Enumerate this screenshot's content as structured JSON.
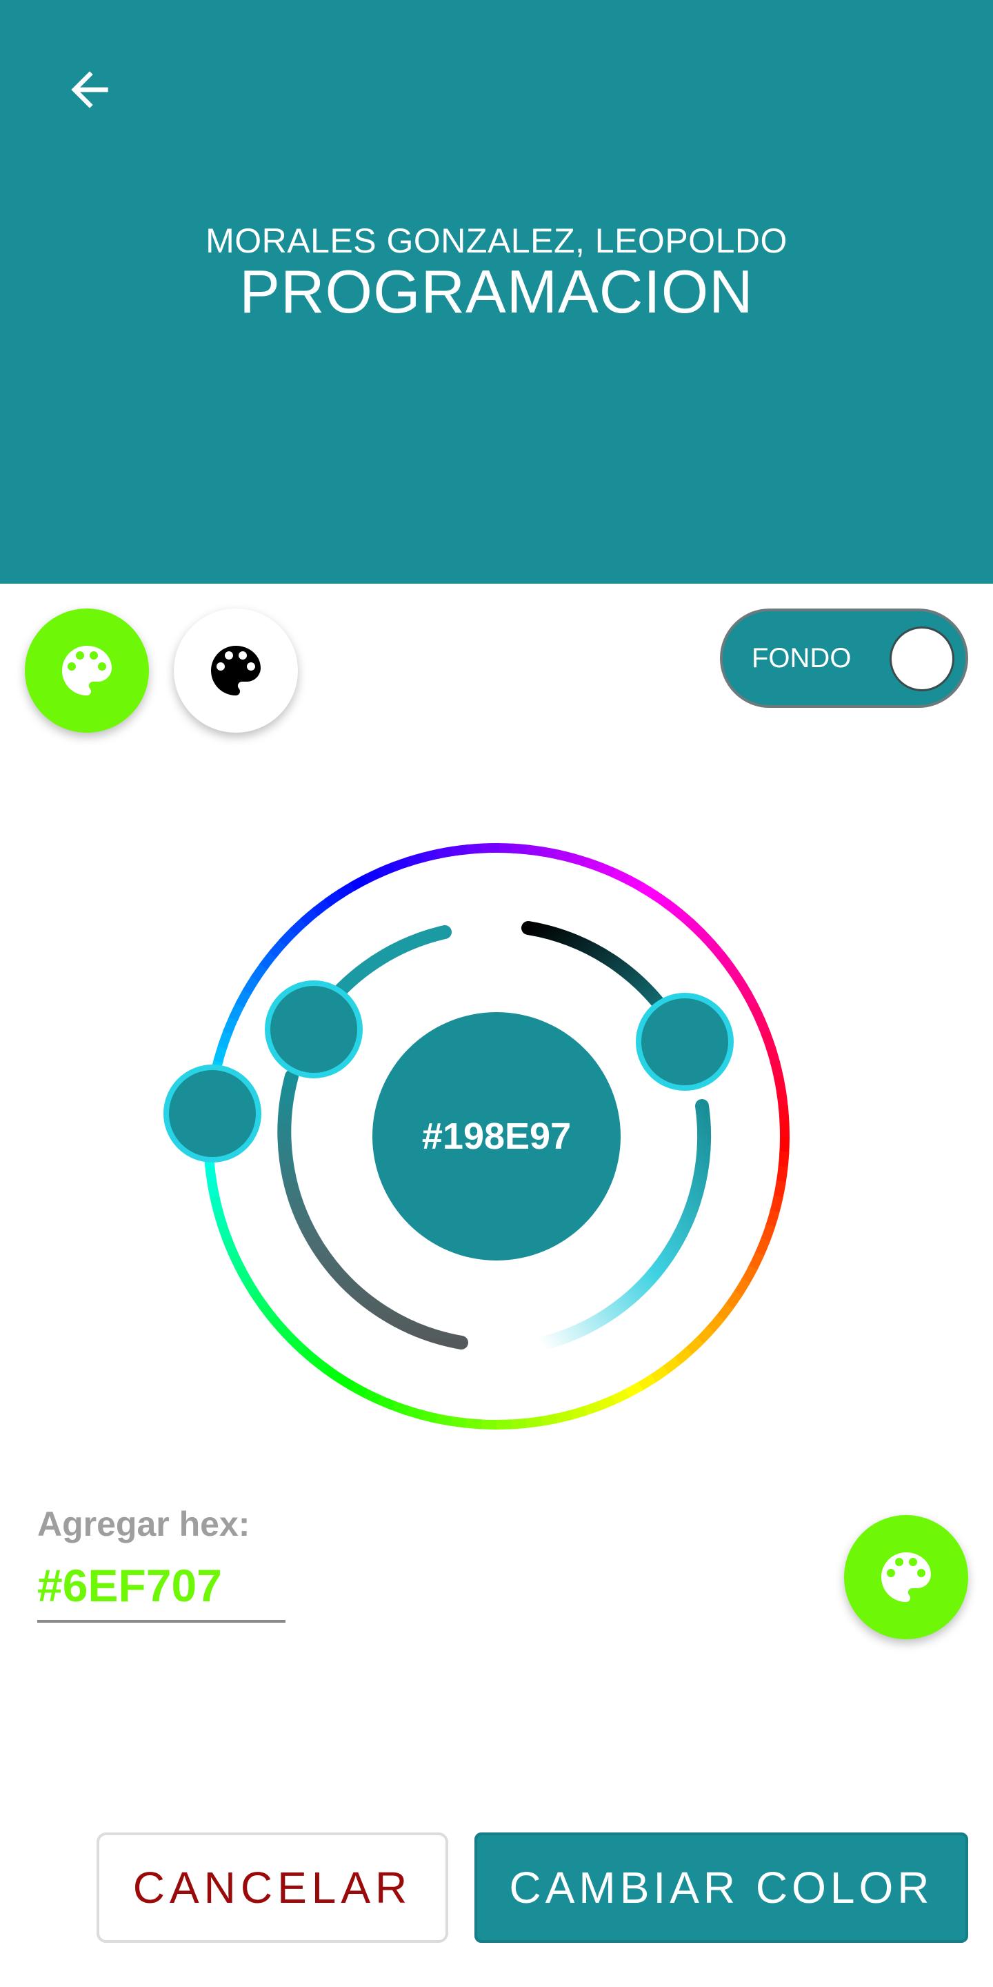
{
  "header": {
    "back_icon": "arrow-left-icon",
    "subtitle": "MORALES GONZALEZ, LEOPOLDO",
    "title": "PROGRAMACION",
    "background_color": "#198E97"
  },
  "toolbar": {
    "foreground_palette_icon": "palette-icon",
    "background_palette_icon": "palette-icon",
    "toggle_label": "FONDO"
  },
  "color_picker": {
    "selected_hex": "#198E97",
    "hue_ring": "full-spectrum",
    "saturation_arc": "turquoise-to-white",
    "value_arc": "turquoise-to-black"
  },
  "hex_entry": {
    "caption": "Agregar hex:",
    "value": "#6EF707",
    "apply_icon": "palette-icon"
  },
  "actions": {
    "cancel_label": "CANCELAR",
    "confirm_label": "CAMBIAR COLOR"
  },
  "colors": {
    "accent": "#198E97",
    "lime": "#6EF707",
    "cancel_text": "#9B0A0A",
    "handle_border": "#29D3E6"
  }
}
